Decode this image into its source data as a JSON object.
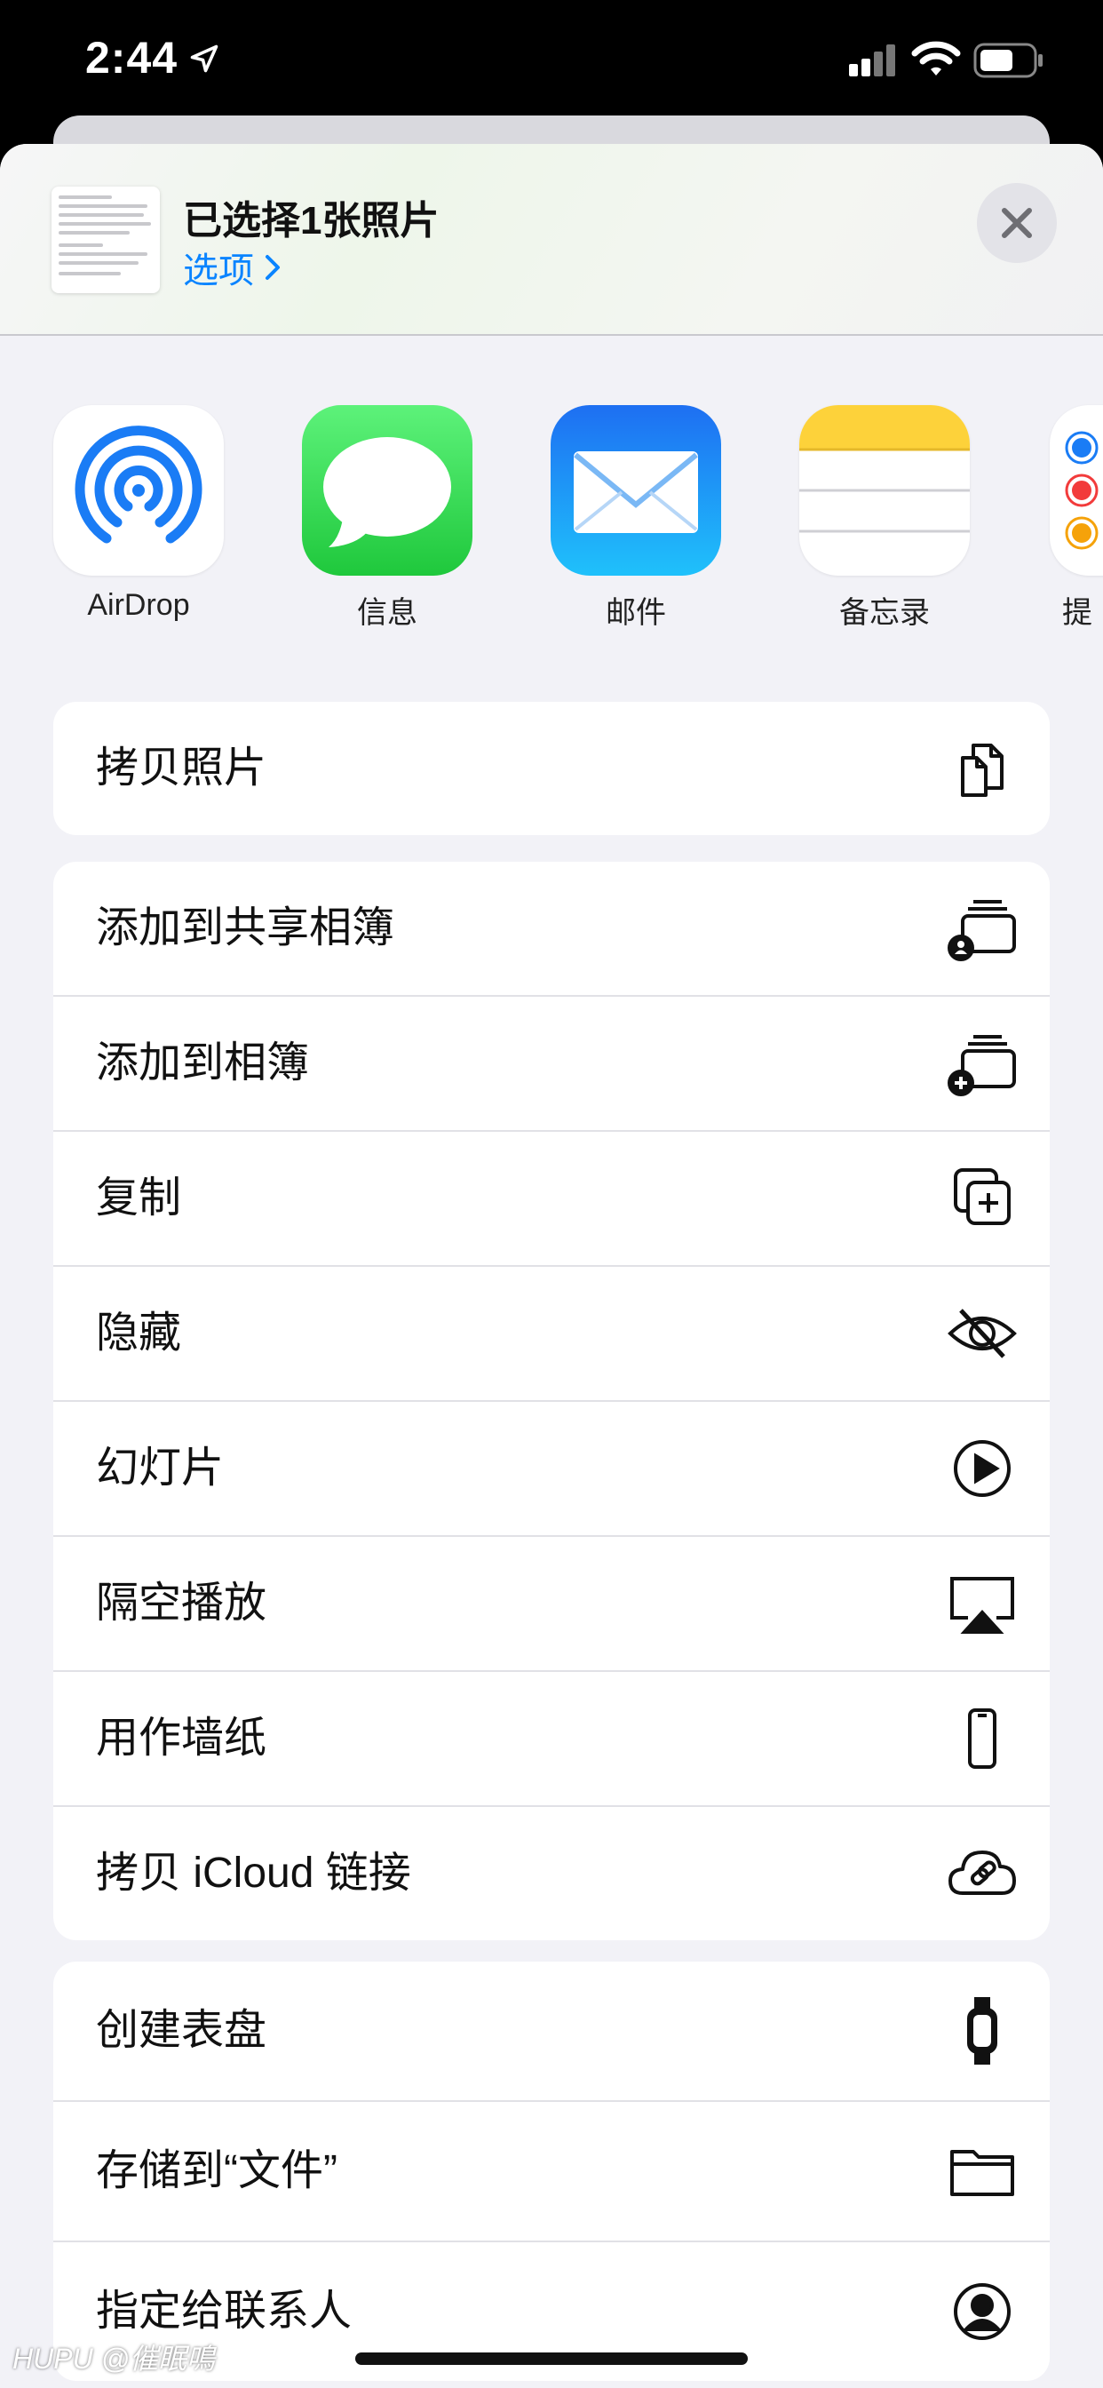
{
  "status_bar": {
    "time": "2:44"
  },
  "header": {
    "title": "已选择1张照片",
    "options_label": "选项"
  },
  "apps": [
    {
      "name": "AirDrop",
      "icon": "airdrop-icon"
    },
    {
      "name": "信息",
      "icon": "messages-icon"
    },
    {
      "name": "邮件",
      "icon": "mail-icon"
    },
    {
      "name": "备忘录",
      "icon": "notes-icon"
    },
    {
      "name": "提",
      "icon": "reminders-icon"
    }
  ],
  "actions_group1": [
    {
      "label": "拷贝照片",
      "icon": "copy-photo-icon"
    }
  ],
  "actions_group2": [
    {
      "label": "添加到共享相簿",
      "icon": "shared-album-icon"
    },
    {
      "label": "添加到相簿",
      "icon": "add-album-icon"
    },
    {
      "label": "复制",
      "icon": "duplicate-icon"
    },
    {
      "label": "隐藏",
      "icon": "eye-slash-icon"
    },
    {
      "label": "幻灯片",
      "icon": "play-circle-icon"
    },
    {
      "label": "隔空播放",
      "icon": "airplay-icon"
    },
    {
      "label": "用作墙纸",
      "icon": "iphone-icon"
    },
    {
      "label": "拷贝 iCloud 链接",
      "icon": "cloud-link-icon"
    }
  ],
  "actions_group3": [
    {
      "label": "创建表盘",
      "icon": "watch-icon"
    },
    {
      "label": "存储到“文件”",
      "icon": "folder-icon"
    },
    {
      "label": "指定给联系人",
      "icon": "contact-icon"
    }
  ],
  "watermark": "HUPU @催眠鳴",
  "colors": {
    "accent": "#0a84ff",
    "sheet_bg": "#f2f2f7",
    "messages_green": "#34c759",
    "mail_blue": "#1a8cff",
    "notes_yellow": "#ffd60a"
  }
}
